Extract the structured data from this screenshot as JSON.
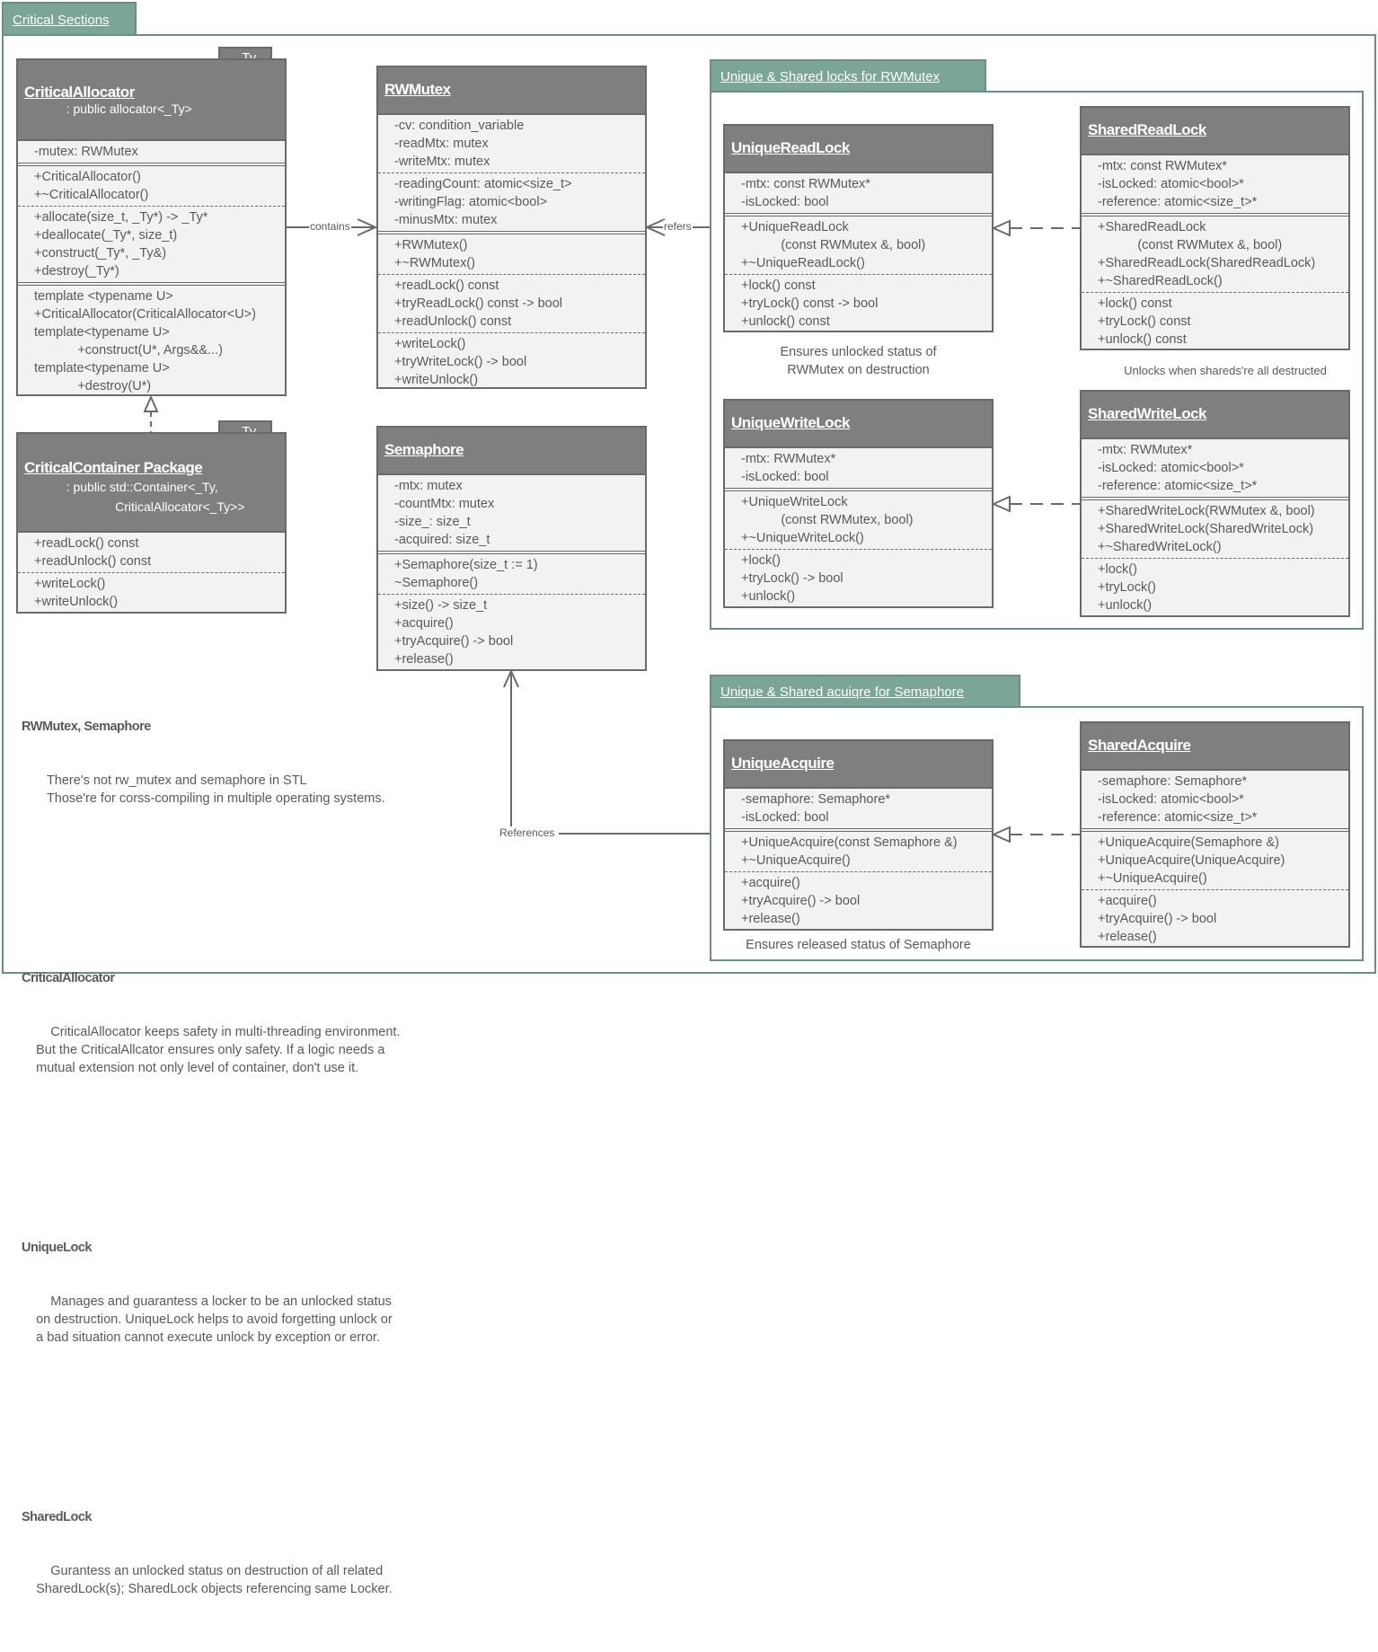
{
  "main_package": {
    "title": "Critical Sections"
  },
  "packages": {
    "locks": {
      "title": "Unique & Shared locks for RWMutex"
    },
    "acquire": {
      "title": "Unique & Shared acuiqre for Semaphore"
    }
  },
  "classes": {
    "critical_allocator": {
      "name": "CriticalAllocator",
      "subtitle": "            : public allocator<_Ty>",
      "template_param": "_Ty",
      "sections": [
        [
          "-mutex: RWMutex"
        ],
        [
          "+CriticalAllocator()",
          "+~CriticalAllocator()"
        ],
        [
          "+allocate(size_t, _Ty*) -> _Ty*",
          "+deallocate(_Ty*, size_t)",
          "+construct(_Ty*, _Ty&)",
          "+destroy(_Ty*)"
        ],
        [
          "template <typename U>",
          "+CriticalAllocator(CriticalAllocator<U>)",
          "template<typename U>",
          "            +construct(U*, Args&&...)",
          "template<typename U>",
          "            +destroy(U*)"
        ]
      ]
    },
    "critical_container": {
      "name": "CriticalContainer Package",
      "subtitle": "            : public std::Container<_Ty,\n                          CriticalAllocator<_Ty>>",
      "template_param": "_Ty",
      "sections": [
        [
          "+readLock() const",
          "+readUnlock() const"
        ],
        [
          "+writeLock()",
          "+writeUnlock()"
        ]
      ]
    },
    "rwmutex": {
      "name": "RWMutex",
      "sections": [
        [
          "-cv: condition_variable",
          "-readMtx: mutex",
          "-writeMtx: mutex"
        ],
        [
          "-readingCount: atomic<size_t>",
          "-writingFlag: atomic<bool>",
          "-minusMtx: mutex"
        ],
        [
          "+RWMutex()",
          "+~RWMutex()"
        ],
        [
          "+readLock() const",
          "+tryReadLock() const -> bool",
          "+readUnlock() const"
        ],
        [
          "+writeLock()",
          "+tryWriteLock() -> bool",
          "+writeUnlock()"
        ]
      ]
    },
    "semaphore": {
      "name": "Semaphore",
      "sections": [
        [
          "-mtx: mutex",
          "-countMtx: mutex",
          "-size_: size_t",
          "-acquired: size_t"
        ],
        [
          "+Semaphore(size_t := 1)",
          "~Semaphore()"
        ],
        [
          "+size() -> size_t",
          "+acquire()",
          "+tryAcquire() -> bool",
          "+release()"
        ]
      ]
    },
    "unique_read_lock": {
      "name": "UniqueReadLock",
      "sections": [
        [
          "-mtx: const RWMutex*",
          "-isLocked: bool"
        ],
        [
          "+UniqueReadLock",
          "           (const RWMutex &, bool)",
          "+~UniqueReadLock()"
        ],
        [
          "+lock() const",
          "+tryLock() const -> bool",
          "+unlock() const"
        ]
      ]
    },
    "shared_read_lock": {
      "name": "SharedReadLock",
      "sections": [
        [
          "-mtx: const RWMutex*",
          "-isLocked: atomic<bool>*",
          "-reference: atomic<size_t>*"
        ],
        [
          "+SharedReadLock",
          "           (const RWMutex &, bool)",
          "+SharedReadLock(SharedReadLock)",
          "+~SharedReadLock()"
        ],
        [
          "+lock() const",
          "+tryLock() const",
          "+unlock() const"
        ]
      ]
    },
    "unique_write_lock": {
      "name": "UniqueWriteLock",
      "sections": [
        [
          "-mtx: RWMutex*",
          "-isLocked: bool"
        ],
        [
          "+UniqueWriteLock",
          "           (const RWMutex, bool)",
          "+~UniqueWriteLock()"
        ],
        [
          "+lock()",
          "+tryLock() -> bool",
          "+unlock()"
        ]
      ]
    },
    "shared_write_lock": {
      "name": "SharedWriteLock",
      "sections": [
        [
          "-mtx: RWMutex*",
          "-isLocked: atomic<bool>*",
          "-reference: atomic<size_t>*"
        ],
        [
          "+SharedWriteLock(RWMutex &, bool)",
          "+SharedWriteLock(SharedWriteLock)",
          "+~SharedWriteLock()"
        ],
        [
          "+lock()",
          "+tryLock()",
          "+unlock()"
        ]
      ]
    },
    "unique_acquire": {
      "name": "UniqueAcquire",
      "sections": [
        [
          "-semaphore: Semaphore*",
          "-isLocked: bool"
        ],
        [
          "+UniqueAcquire(const Semaphore &)",
          "+~UniqueAcquire()"
        ],
        [
          "+acquire()",
          "+tryAcquire() -> bool",
          "+release()"
        ]
      ]
    },
    "shared_acquire": {
      "name": "SharedAcquire",
      "sections": [
        [
          "-semaphore: Semaphore*",
          "-isLocked: atomic<bool>*",
          "-reference: atomic<size_t>*"
        ],
        [
          "+UniqueAcquire(Semaphore &)",
          "+UniqueAcquire(UniqueAcquire)",
          "+~UniqueAcquire()"
        ],
        [
          "+acquire()",
          "+tryAcquire() -> bool",
          "+release()"
        ]
      ]
    }
  },
  "connectors": {
    "contains": "contains",
    "refers": "refers",
    "references": "References"
  },
  "captions": {
    "unique_read_lock": "Ensures unlocked status of\nRWMutex on destruction",
    "shared_read_lock": "Unlocks when shareds're all destructed",
    "unique_acquire": "Ensures released status of Semaphore"
  },
  "notes": [
    {
      "title": "RWMutex, Semaphore",
      "body": "       There's not rw_mutex and semaphore in STL\n       Those're for corss-compiling in multiple operating systems."
    },
    {
      "title": "CriticalAllocator",
      "body": "        CriticalAllocator keeps safety in multi-threading environment.\n    But the CriticalAllcator ensures only safety. If a logic needs a\n    mutual extension not only level of container, don't use it."
    },
    {
      "title": "UniqueLock",
      "body": "        Manages and guarantess a locker to be an unlocked status\n    on destruction. UniqueLock helps to avoid forgetting unlock or\n    a bad situation cannot execute unlock by exception or error."
    },
    {
      "title": "SharedLock",
      "body": "        Gurantess an unlocked status on destruction of all related\n    SharedLock(s); SharedLock objects referencing same Locker."
    }
  ],
  "colors": {
    "package_fill": "#7aa597",
    "package_border": "#6b8f84",
    "class_header": "#7f7f7f",
    "class_body": "#f2f2f2",
    "class_border": "#6a6a6a",
    "text": "#5a5a5a"
  }
}
